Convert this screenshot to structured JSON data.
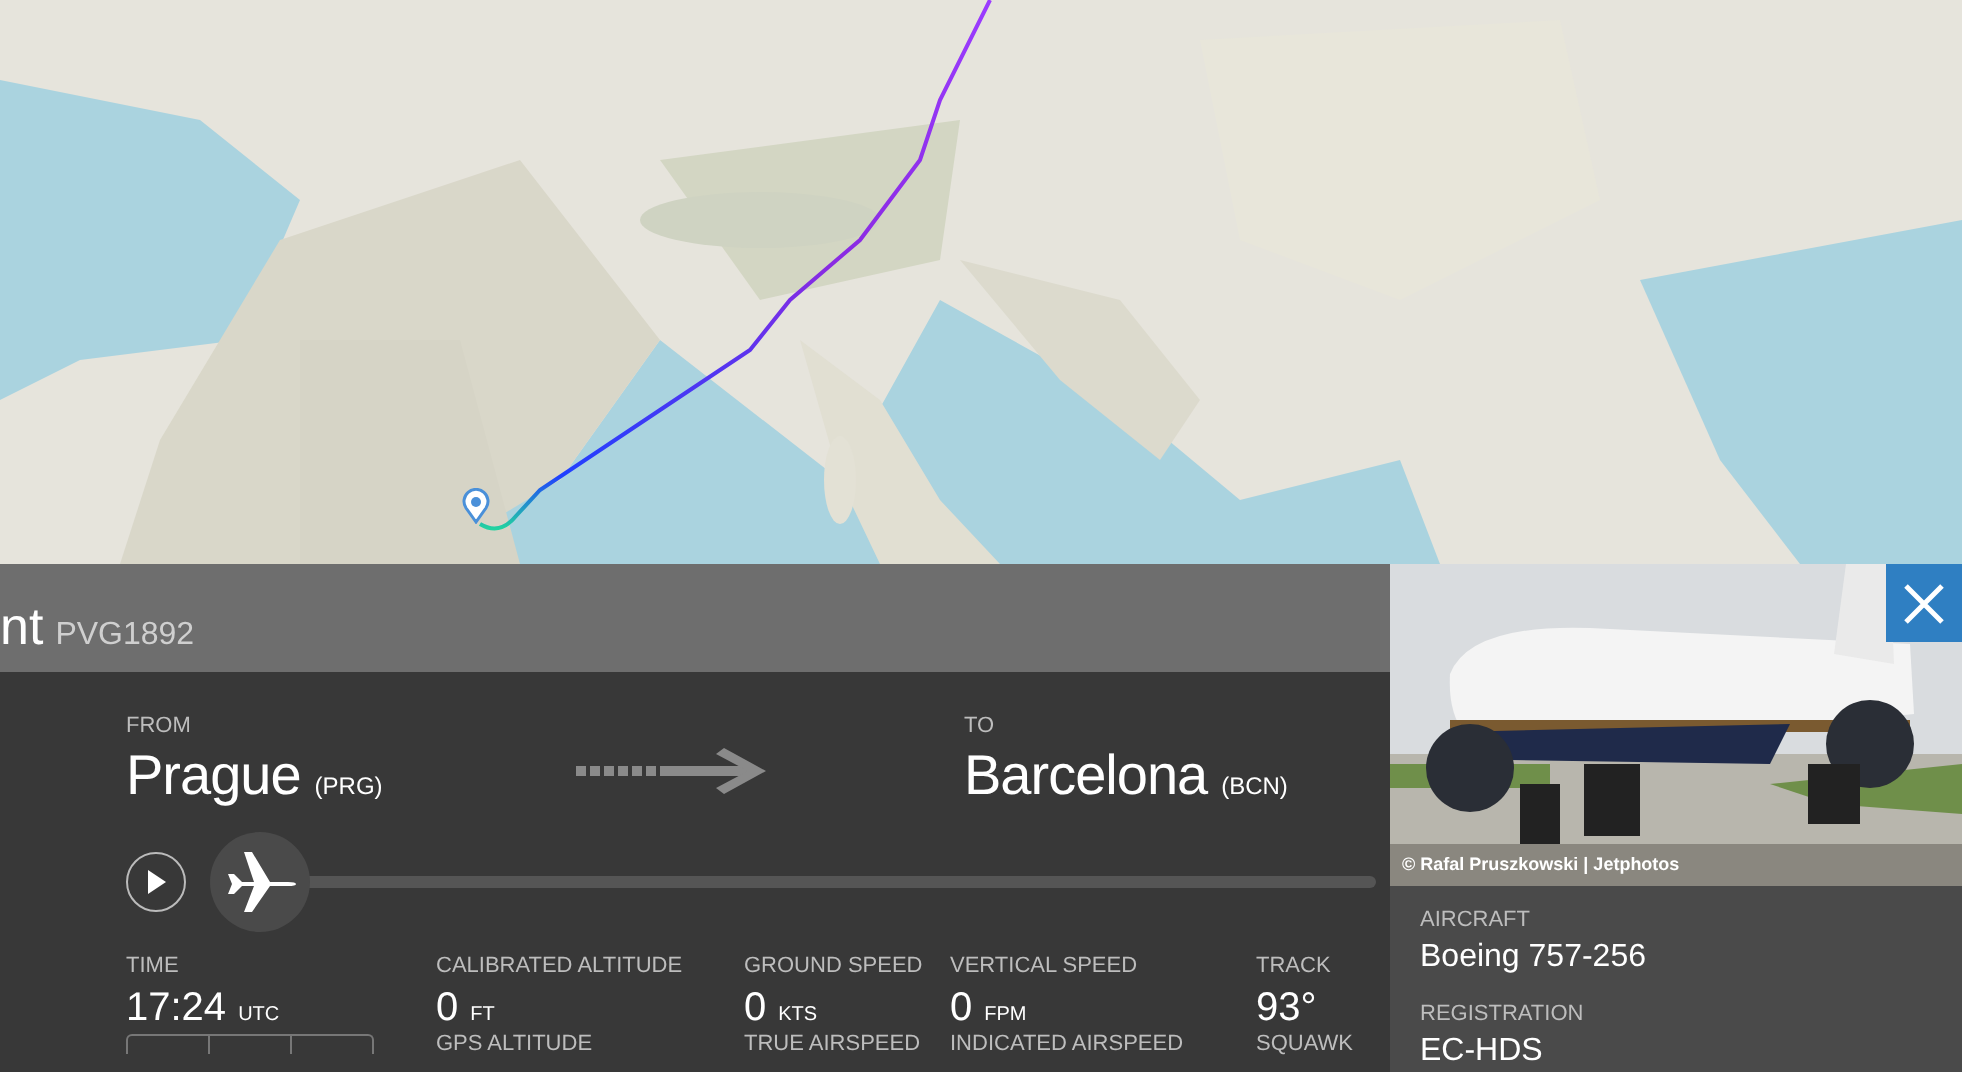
{
  "flight_panel": {
    "title": "nt",
    "callsign": "PVG1892",
    "from": {
      "label": "FROM",
      "city": "Prague",
      "code": "(PRG)"
    },
    "to": {
      "label": "TO",
      "city": "Barcelona",
      "code": "(BCN)"
    },
    "progress": {
      "level": 0
    },
    "stats": [
      {
        "label": "TIME",
        "value": "17:24",
        "unit": "UTC"
      },
      {
        "label": "CALIBRATED ALTITUDE",
        "value": "0",
        "unit": "FT"
      },
      {
        "label": "GROUND SPEED",
        "value": "0",
        "unit": "KTS"
      },
      {
        "label": "VERTICAL SPEED",
        "value": "0",
        "unit": "FPM"
      },
      {
        "label": "TRACK",
        "value": "93°"
      }
    ],
    "stats_row_2": [
      "GPS ALTITUDE",
      "TRUE AIRSPEED",
      "INDICATED AIRSPEED",
      "SQUAWK"
    ]
  },
  "aircraft_panel": {
    "photo_credit": "© Rafal Pruszkowski | Jetphotos",
    "fields": [
      {
        "label": "AIRCRAFT",
        "value": "Boeing 757-256"
      },
      {
        "label": "REGISTRATION",
        "value": "EC-HDS"
      }
    ]
  }
}
